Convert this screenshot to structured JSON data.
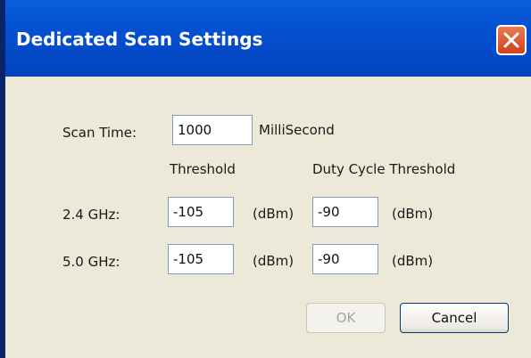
{
  "window": {
    "title": "Dedicated Scan Settings",
    "close_icon": "close-icon",
    "accent_color": "#0450d0"
  },
  "scan_time": {
    "label": "Scan Time:",
    "value": "1000",
    "unit": "MilliSecond"
  },
  "columns": {
    "threshold": "Threshold",
    "duty_cycle_threshold": "Duty Cycle Threshold"
  },
  "rows": [
    {
      "band": "2.4 GHz:",
      "threshold": "-105",
      "threshold_unit": "(dBm)",
      "duty_cycle": "-90",
      "duty_cycle_unit": "(dBm)"
    },
    {
      "band": "5.0 GHz:",
      "threshold": "-105",
      "threshold_unit": "(dBm)",
      "duty_cycle": "-90",
      "duty_cycle_unit": "(dBm)"
    }
  ],
  "buttons": {
    "ok": "OK",
    "cancel": "Cancel"
  }
}
